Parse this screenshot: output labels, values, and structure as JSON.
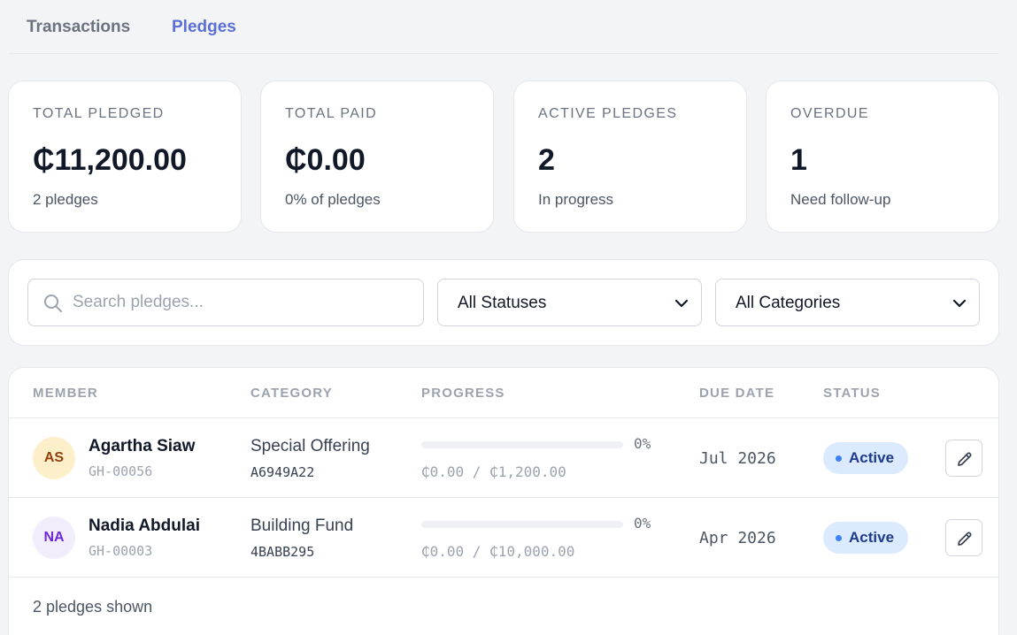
{
  "tabs": [
    {
      "label": "Transactions",
      "active": false
    },
    {
      "label": "Pledges",
      "active": true
    }
  ],
  "stats": [
    {
      "label": "TOTAL PLEDGED",
      "value": "₵11,200.00",
      "sub": "2 pledges"
    },
    {
      "label": "TOTAL PAID",
      "value": "₵0.00",
      "sub": "0% of pledges"
    },
    {
      "label": "ACTIVE PLEDGES",
      "value": "2",
      "sub": "In progress"
    },
    {
      "label": "OVERDUE",
      "value": "1",
      "sub": "Need follow-up"
    }
  ],
  "filters": {
    "search_placeholder": "Search pledges...",
    "search_value": "",
    "status_selected": "All Statuses",
    "category_selected": "All Categories"
  },
  "table": {
    "headers": {
      "member": "MEMBER",
      "category": "CATEGORY",
      "progress": "PROGRESS",
      "due_date": "DUE DATE",
      "status": "STATUS"
    },
    "rows": [
      {
        "initials": "AS",
        "avatar_bg": "#fdefc9",
        "avatar_fg": "#92400e",
        "name": "Agartha Siaw",
        "member_id": "GH-00056",
        "category": "Special Offering",
        "category_code": "A6949A22",
        "progress_fraction": 0,
        "progress_pct": "0%",
        "amount": "₵0.00 / ₵1,200.00",
        "due_date": "Jul 2026",
        "status": "Active"
      },
      {
        "initials": "NA",
        "avatar_bg": "#f1edfb",
        "avatar_fg": "#6d28d9",
        "name": "Nadia Abdulai",
        "member_id": "GH-00003",
        "category": "Building Fund",
        "category_code": "4BABB295",
        "progress_fraction": 0,
        "progress_pct": "0%",
        "amount": "₵0.00 / ₵10,000.00",
        "due_date": "Apr 2026",
        "status": "Active"
      }
    ],
    "footer": "2 pledges shown"
  },
  "colors": {
    "accent": "#5b6fd6",
    "status_active_bg": "#dbeafe",
    "status_active_text": "#1e3a8a"
  },
  "icons": {
    "search": "search-icon",
    "chevron": "chevron-down-icon",
    "edit": "pencil-icon"
  }
}
